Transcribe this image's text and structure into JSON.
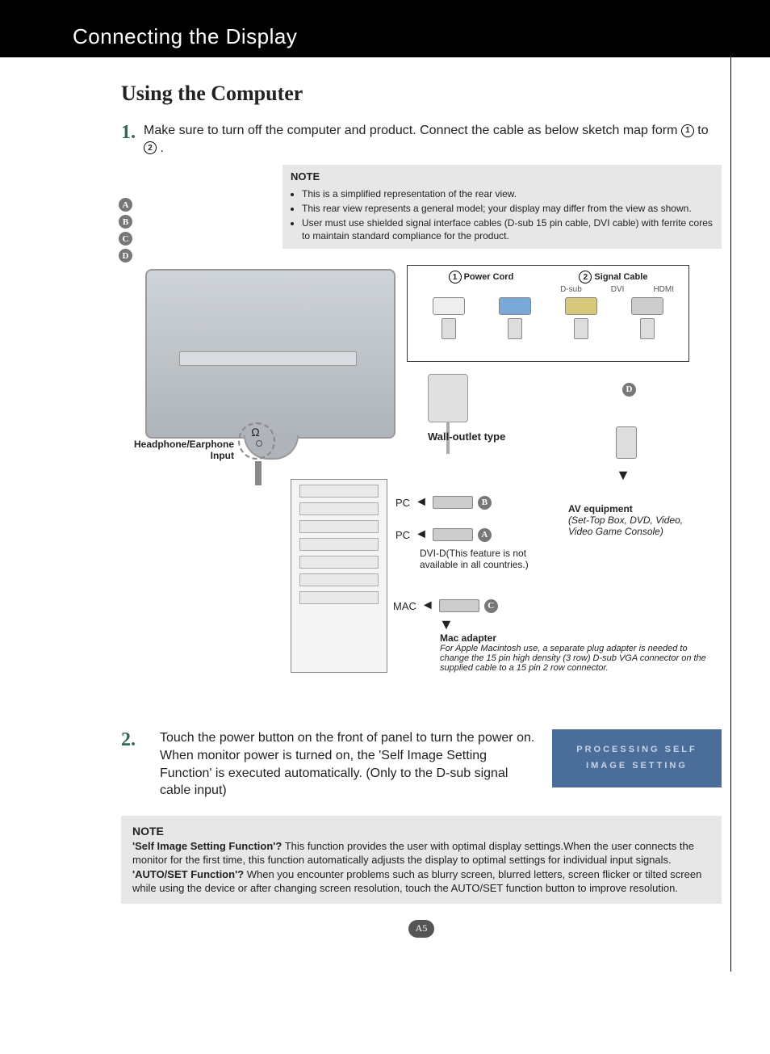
{
  "header": {
    "title": "Connecting the Display"
  },
  "section_title": "Using the Computer",
  "step1": {
    "num": "1.",
    "text_a": "Make sure to turn off the computer and  product. Connect the cable as below sketch map form ",
    "circ1": "1",
    "text_b": " to ",
    "circ2": "2",
    "text_c": " ."
  },
  "letters": {
    "a": "A",
    "b": "B",
    "c": "C",
    "d": "D"
  },
  "note1": {
    "title": "NOTE",
    "items": [
      "This is a simplified representation of the rear view.",
      "This rear view represents a general model; your display may differ from the view as shown.",
      "User must use shielded signal interface cables (D-sub 15 pin cable, DVI cable) with ferrite cores to maintain standard compliance for the product."
    ]
  },
  "diagram": {
    "panel_num1": "1",
    "panel_label1": "Power Cord",
    "panel_num2": "2",
    "panel_label2": "Signal Cable",
    "dsub": "D-sub",
    "dvi": "DVI",
    "hdmi": "HDMI",
    "headphone_label": "Headphone/Earphone Input",
    "wall_label": "Wall-outlet type",
    "pc1": "PC",
    "pc2": "PC",
    "mac": "MAC",
    "dvi_note": "DVI-D(This feature is not available in all countries.)",
    "av_title": "AV equipment",
    "av_sub": "(Set-Top Box, DVD, Video, Video Game Console)",
    "mac_title": "Mac adapter",
    "mac_sub": "For Apple Macintosh use, a  separate plug adapter is needed to change the 15 pin high density (3 row) D-sub VGA connector on the supplied cable to a 15 pin  2 row connector."
  },
  "step2": {
    "num": "2.",
    "text": "Touch the power button on the front of panel to turn the power on. When monitor power is turned on, the 'Self Image Setting Function' is executed automatically. (Only to the D-sub signal cable input)",
    "osd_line1": "PROCESSING SELF",
    "osd_line2": "IMAGE SETTING"
  },
  "note2": {
    "title": "NOTE",
    "q1": "'Self Image Setting Function'?",
    "a1": " This function provides the user with optimal display settings.When the user connects the monitor for the first time, this function automatically adjusts the display to optimal settings for individual input signals.",
    "q2": "'AUTO/SET Function'?",
    "a2": " When you encounter problems such as blurry screen, blurred letters, screen flicker or tilted screen while using the device or after changing screen resolution, touch the AUTO/SET function button to improve resolution."
  },
  "page_no": "A5"
}
